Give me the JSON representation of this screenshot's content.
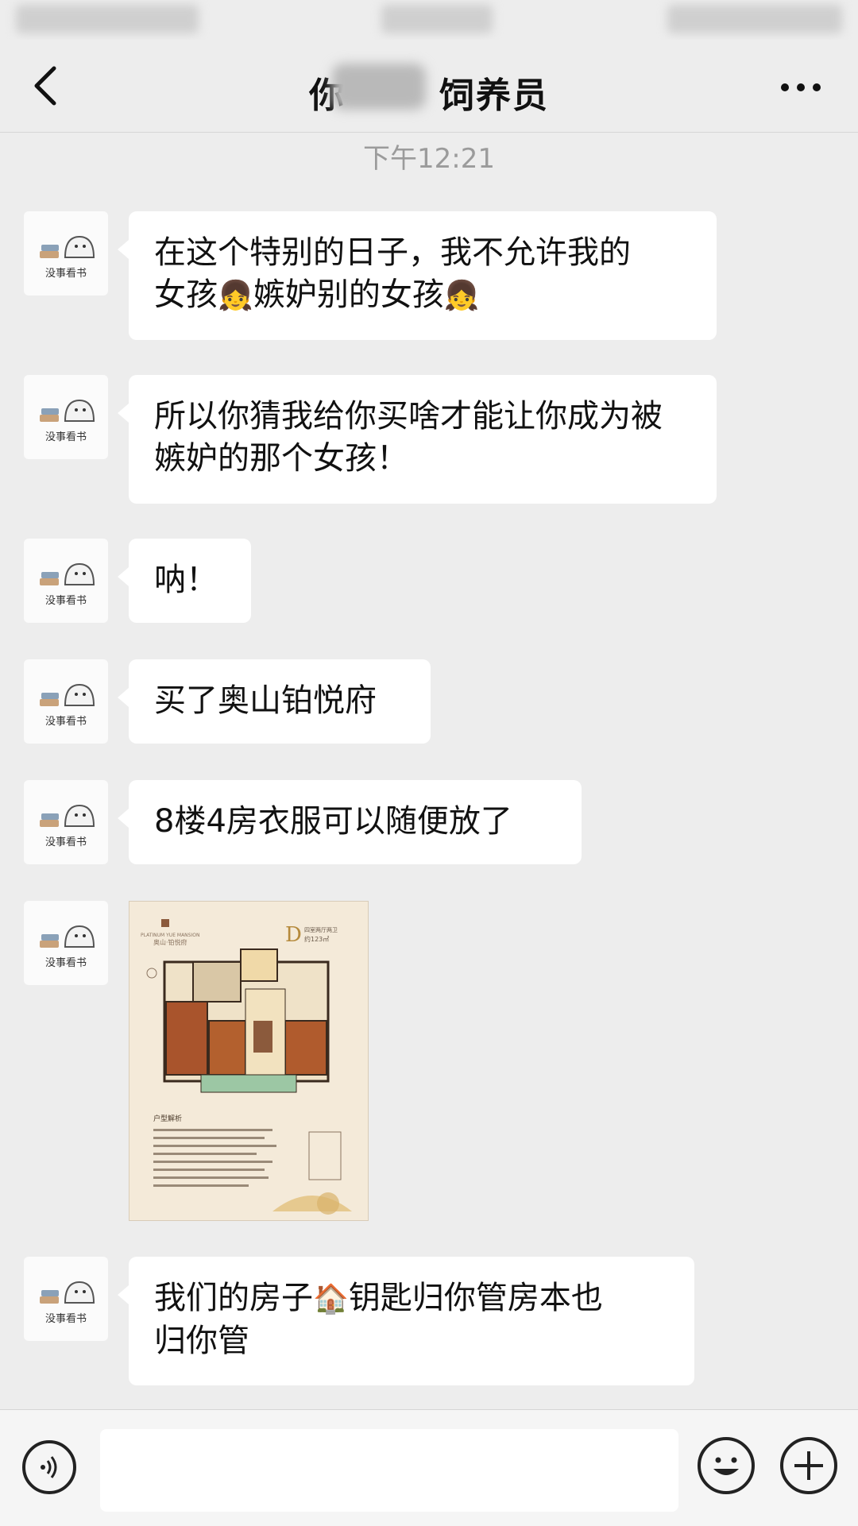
{
  "header": {
    "title_left": "你",
    "title_right": "饲养员"
  },
  "timestamp": "下午12:21",
  "avatar_text": "没事看书",
  "messages": [
    {
      "lines": [
        "在这个特别的日子，我不允许我的",
        "女孩",
        "嫉妒别的女孩"
      ],
      "emojis": [
        "girl-emoji",
        "girl-emoji"
      ]
    },
    {
      "text": "所以你猜我给你买啥才能让你成为被嫉妒的那个女孩！"
    },
    {
      "text": "呐！"
    },
    {
      "text": "买了奥山铂悦府"
    },
    {
      "text": "8楼4房衣服可以随便放了"
    },
    {
      "image": {
        "brand": "奥山·铂悦府",
        "brand_en": "PLATINUM YUE MANSION",
        "unit_letter": "D",
        "unit_type": "四室两厅两卫",
        "area": "约123㎡",
        "caption": "户型解析"
      }
    },
    {
      "parts": [
        "我们的房子",
        "钥匙归你管房本也",
        "归你管"
      ],
      "emojis": [
        "house-emoji"
      ]
    }
  ],
  "colors": {
    "background": "#ededed",
    "bubble": "#ffffff",
    "timestamp": "#9b9b9b"
  }
}
